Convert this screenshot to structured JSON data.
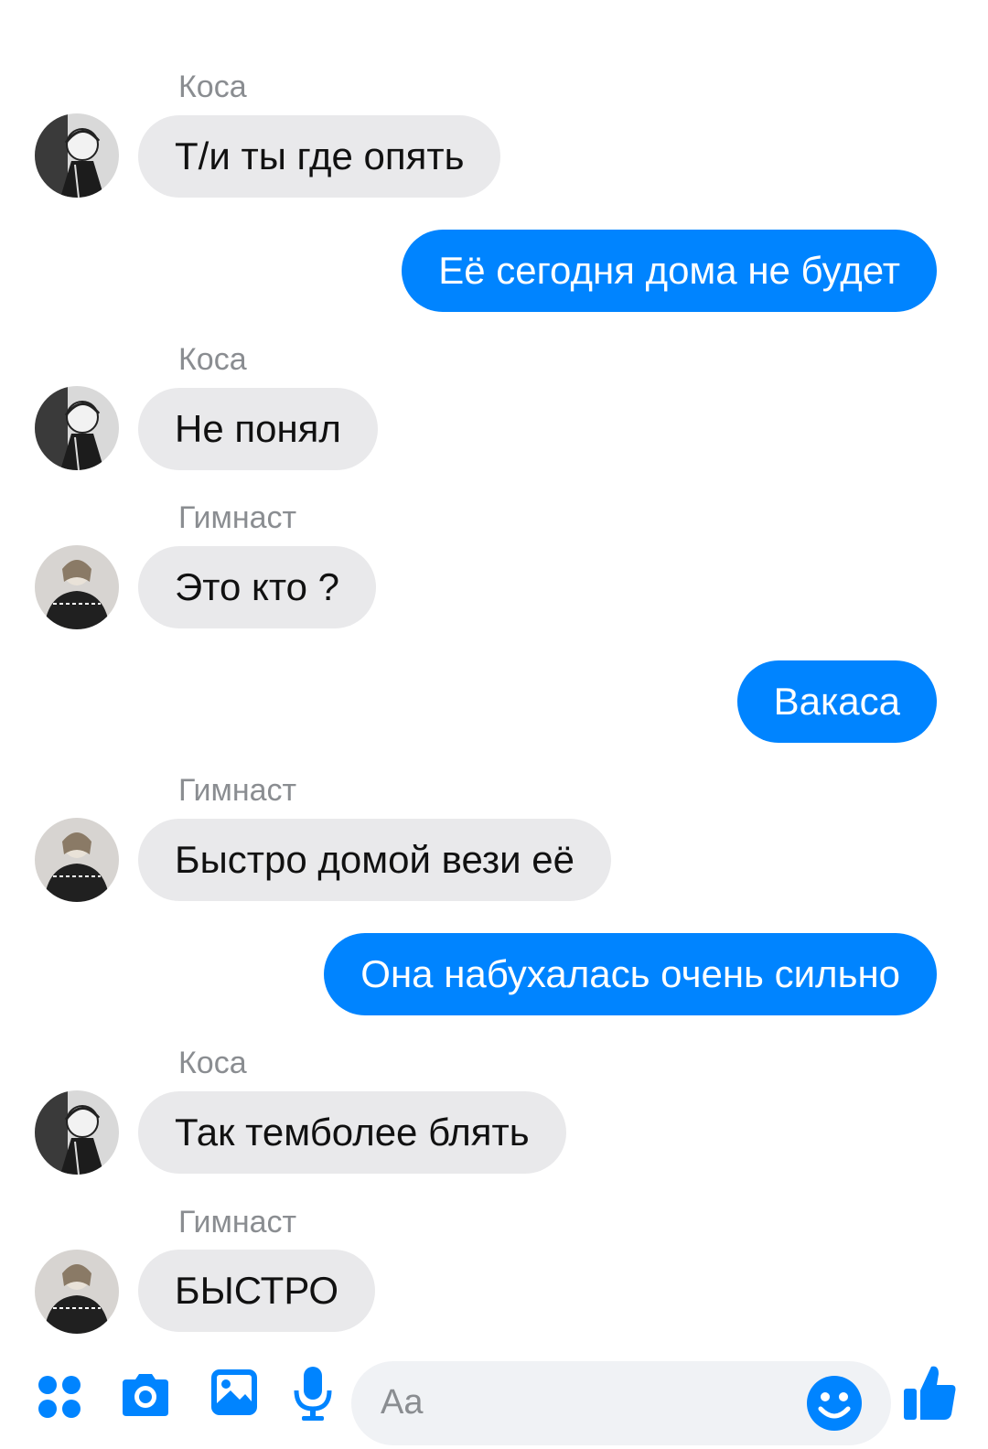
{
  "messages": [
    {
      "sender": "Коса",
      "direction": "in",
      "avatar": "kosa",
      "text": "Т/и ты где опять"
    },
    {
      "sender": "",
      "direction": "out",
      "text": "Её сегодня дома не будет"
    },
    {
      "sender": "Коса",
      "direction": "in",
      "avatar": "kosa",
      "text": "Не понял"
    },
    {
      "sender": "Гимнаст",
      "direction": "in",
      "avatar": "gimnast",
      "text": "Это кто ?"
    },
    {
      "sender": "",
      "direction": "out",
      "text": "Вакаса"
    },
    {
      "sender": "Гимнаст",
      "direction": "in",
      "avatar": "gimnast",
      "text": "Быстро домой вези её"
    },
    {
      "sender": "",
      "direction": "out",
      "text": "Она набухалась очень сильно"
    },
    {
      "sender": "Коса",
      "direction": "in",
      "avatar": "kosa",
      "text": "Так темболее блять"
    },
    {
      "sender": "Гимнаст",
      "direction": "in",
      "avatar": "gimnast",
      "text": "БЫСТРО"
    }
  ],
  "composer": {
    "placeholder": "Aa",
    "icons": [
      "menu-dots-icon",
      "camera-icon",
      "gallery-icon",
      "microphone-icon",
      "emoji-icon",
      "thumbs-up-icon"
    ]
  },
  "colors": {
    "accent": "#0084ff",
    "incoming_bubble": "#e9e9eb",
    "sender_name": "#8a8d91"
  }
}
